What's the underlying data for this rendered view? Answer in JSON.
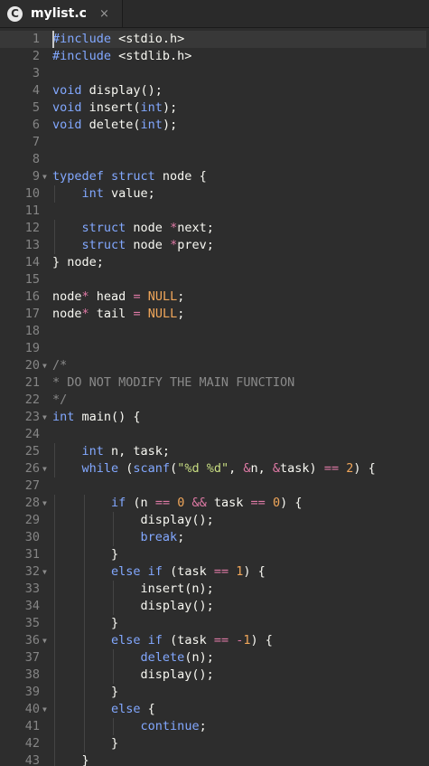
{
  "tab": {
    "icon_letter": "C",
    "title": "mylist.c",
    "close": "×"
  },
  "editor": {
    "active_line": 1,
    "lines": [
      {
        "n": "1",
        "t": [
          [
            "k",
            "#include"
          ],
          [
            "p",
            " <stdio.h>"
          ]
        ]
      },
      {
        "n": "2",
        "t": [
          [
            "k",
            "#include"
          ],
          [
            "p",
            " <stdlib.h>"
          ]
        ]
      },
      {
        "n": "3",
        "t": []
      },
      {
        "n": "4",
        "t": [
          [
            "k",
            "void"
          ],
          [
            "p",
            " display();"
          ]
        ]
      },
      {
        "n": "5",
        "t": [
          [
            "k",
            "void"
          ],
          [
            "p",
            " insert("
          ],
          [
            "k",
            "int"
          ],
          [
            "p",
            ");"
          ]
        ]
      },
      {
        "n": "6",
        "t": [
          [
            "k",
            "void"
          ],
          [
            "p",
            " delete("
          ],
          [
            "k",
            "int"
          ],
          [
            "p",
            ");"
          ]
        ]
      },
      {
        "n": "7",
        "t": []
      },
      {
        "n": "8",
        "t": []
      },
      {
        "n": "9",
        "fold": true,
        "t": [
          [
            "k",
            "typedef struct"
          ],
          [
            "p",
            " node {"
          ]
        ]
      },
      {
        "n": "10",
        "t": [
          [
            "p",
            "    "
          ],
          [
            "k",
            "int"
          ],
          [
            "p",
            " value;"
          ]
        ]
      },
      {
        "n": "11",
        "t": []
      },
      {
        "n": "12",
        "t": [
          [
            "p",
            "    "
          ],
          [
            "k",
            "struct"
          ],
          [
            "p",
            " node "
          ],
          [
            "op",
            "*"
          ],
          [
            "p",
            "next;"
          ]
        ]
      },
      {
        "n": "13",
        "t": [
          [
            "p",
            "    "
          ],
          [
            "k",
            "struct"
          ],
          [
            "p",
            " node "
          ],
          [
            "op",
            "*"
          ],
          [
            "p",
            "prev;"
          ]
        ]
      },
      {
        "n": "14",
        "t": [
          [
            "p",
            "} node;"
          ]
        ]
      },
      {
        "n": "15",
        "t": []
      },
      {
        "n": "16",
        "t": [
          [
            "p",
            "node"
          ],
          [
            "op",
            "*"
          ],
          [
            "p",
            " head "
          ],
          [
            "op",
            "="
          ],
          [
            "p",
            " "
          ],
          [
            "n",
            "NULL"
          ],
          [
            "p",
            ";"
          ]
        ]
      },
      {
        "n": "17",
        "t": [
          [
            "p",
            "node"
          ],
          [
            "op",
            "*"
          ],
          [
            "p",
            " tail "
          ],
          [
            "op",
            "="
          ],
          [
            "p",
            " "
          ],
          [
            "n",
            "NULL"
          ],
          [
            "p",
            ";"
          ]
        ]
      },
      {
        "n": "18",
        "t": []
      },
      {
        "n": "19",
        "t": []
      },
      {
        "n": "20",
        "fold": true,
        "t": [
          [
            "c",
            "/*"
          ]
        ]
      },
      {
        "n": "21",
        "t": [
          [
            "c",
            "* DO NOT MODIFY THE MAIN FUNCTION"
          ]
        ]
      },
      {
        "n": "22",
        "t": [
          [
            "c",
            "*/"
          ]
        ]
      },
      {
        "n": "23",
        "fold": true,
        "t": [
          [
            "k",
            "int"
          ],
          [
            "p",
            " main() {"
          ]
        ]
      },
      {
        "n": "24",
        "t": []
      },
      {
        "n": "25",
        "t": [
          [
            "p",
            "    "
          ],
          [
            "k",
            "int"
          ],
          [
            "p",
            " n, task;"
          ]
        ]
      },
      {
        "n": "26",
        "fold": true,
        "t": [
          [
            "p",
            "    "
          ],
          [
            "k",
            "while"
          ],
          [
            "p",
            " ("
          ],
          [
            "k",
            "scanf"
          ],
          [
            "p",
            "("
          ],
          [
            "s",
            "\"%d %d\""
          ],
          [
            "p",
            ", "
          ],
          [
            "op",
            "&"
          ],
          [
            "p",
            "n, "
          ],
          [
            "op",
            "&"
          ],
          [
            "p",
            "task) "
          ],
          [
            "op",
            "=="
          ],
          [
            "p",
            " "
          ],
          [
            "n",
            "2"
          ],
          [
            "p",
            ") {"
          ]
        ]
      },
      {
        "n": "27",
        "t": []
      },
      {
        "n": "28",
        "fold": true,
        "t": [
          [
            "p",
            "        "
          ],
          [
            "k",
            "if"
          ],
          [
            "p",
            " (n "
          ],
          [
            "op",
            "=="
          ],
          [
            "p",
            " "
          ],
          [
            "n",
            "0"
          ],
          [
            "p",
            " "
          ],
          [
            "op",
            "&&"
          ],
          [
            "p",
            " task "
          ],
          [
            "op",
            "=="
          ],
          [
            "p",
            " "
          ],
          [
            "n",
            "0"
          ],
          [
            "p",
            ") {"
          ]
        ]
      },
      {
        "n": "29",
        "t": [
          [
            "p",
            "            display();"
          ]
        ]
      },
      {
        "n": "30",
        "t": [
          [
            "p",
            "            "
          ],
          [
            "k",
            "break"
          ],
          [
            "p",
            ";"
          ]
        ]
      },
      {
        "n": "31",
        "t": [
          [
            "p",
            "        }"
          ]
        ]
      },
      {
        "n": "32",
        "fold": true,
        "t": [
          [
            "p",
            "        "
          ],
          [
            "k",
            "else if"
          ],
          [
            "p",
            " (task "
          ],
          [
            "op",
            "=="
          ],
          [
            "p",
            " "
          ],
          [
            "n",
            "1"
          ],
          [
            "p",
            ") {"
          ]
        ]
      },
      {
        "n": "33",
        "t": [
          [
            "p",
            "            insert(n);"
          ]
        ]
      },
      {
        "n": "34",
        "t": [
          [
            "p",
            "            display();"
          ]
        ]
      },
      {
        "n": "35",
        "t": [
          [
            "p",
            "        }"
          ]
        ]
      },
      {
        "n": "36",
        "fold": true,
        "t": [
          [
            "p",
            "        "
          ],
          [
            "k",
            "else if"
          ],
          [
            "p",
            " (task "
          ],
          [
            "op",
            "=="
          ],
          [
            "p",
            " "
          ],
          [
            "op",
            "-"
          ],
          [
            "n",
            "1"
          ],
          [
            "p",
            ") {"
          ]
        ]
      },
      {
        "n": "37",
        "t": [
          [
            "p",
            "            "
          ],
          [
            "k",
            "delete"
          ],
          [
            "p",
            "(n);"
          ]
        ]
      },
      {
        "n": "38",
        "t": [
          [
            "p",
            "            display();"
          ]
        ]
      },
      {
        "n": "39",
        "t": [
          [
            "p",
            "        }"
          ]
        ]
      },
      {
        "n": "40",
        "fold": true,
        "t": [
          [
            "p",
            "        "
          ],
          [
            "k",
            "else"
          ],
          [
            "p",
            " {"
          ]
        ]
      },
      {
        "n": "41",
        "t": [
          [
            "p",
            "            "
          ],
          [
            "k",
            "continue"
          ],
          [
            "p",
            ";"
          ]
        ]
      },
      {
        "n": "42",
        "t": [
          [
            "p",
            "        }"
          ]
        ]
      },
      {
        "n": "43",
        "t": [
          [
            "p",
            "    }"
          ]
        ]
      }
    ]
  },
  "colors": {
    "background": "#2d2d2d",
    "keyword": "#82a8ff",
    "number": "#f0a65a",
    "string": "#c8dd82",
    "comment": "#8a8a8a",
    "operator": "#e07aa6",
    "text": "#f8f8f2",
    "line_number": "#858585"
  }
}
